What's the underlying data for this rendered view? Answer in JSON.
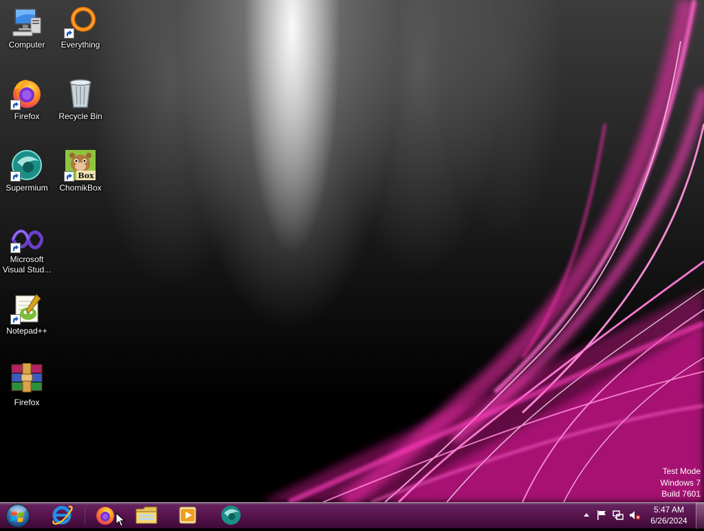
{
  "desktop": {
    "icons": [
      {
        "label": "Computer",
        "icon": "computer-icon"
      },
      {
        "label": "Everything",
        "icon": "everything-search-icon"
      },
      {
        "label": "Firefox",
        "icon": "firefox-icon"
      },
      {
        "label": "Recycle Bin",
        "icon": "recycle-bin-icon"
      },
      {
        "label": "Supermium",
        "icon": "supermium-icon"
      },
      {
        "label": "ChomikBox",
        "icon": "chomikbox-icon"
      },
      {
        "label": "Microsoft Visual Stud...",
        "icon": "visual-studio-icon"
      },
      {
        "label": "Notepad++",
        "icon": "notepad-plus-plus-icon"
      },
      {
        "label": "Firefox",
        "icon": "winrar-icon"
      }
    ],
    "chomikbox_badge": "Box"
  },
  "watermark": {
    "line1": "Test Mode",
    "line2": "Windows 7",
    "line3": "Build 7601"
  },
  "taskbar": {
    "start": {
      "icon": "windows-start-orb-icon"
    },
    "pinned": [
      {
        "name": "Internet Explorer",
        "icon": "internet-explorer-icon"
      },
      {
        "name": "Firefox",
        "icon": "firefox-icon",
        "active": true
      },
      {
        "name": "Windows Explorer",
        "icon": "folder-icon"
      },
      {
        "name": "Media Player",
        "icon": "media-player-icon"
      },
      {
        "name": "Supermium",
        "icon": "supermium-icon"
      }
    ],
    "tray": {
      "icons": [
        "show-hidden-icons-arrow",
        "action-center-flag-icon",
        "network-icon",
        "volume-muted-icon"
      ],
      "time": "5:47 AM",
      "date": "6/26/2024"
    }
  },
  "colors": {
    "accent": "#e0179a",
    "taskbar": "#5a1550"
  }
}
